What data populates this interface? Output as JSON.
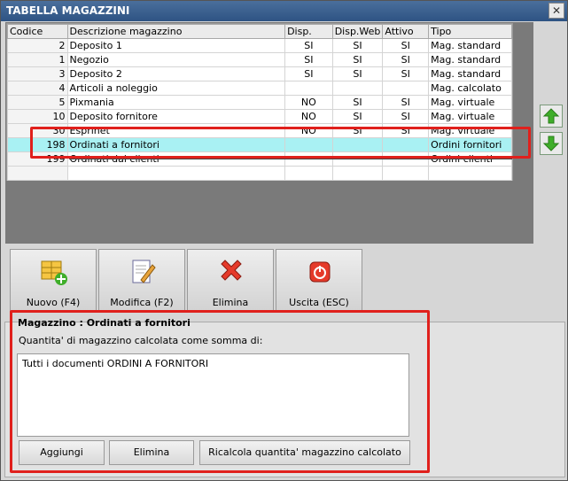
{
  "window": {
    "title": "TABELLA MAGAZZINI",
    "close_glyph": "✕"
  },
  "grid": {
    "columns": [
      "Codice",
      "Descrizione magazzino",
      "Disp.",
      "Disp.Web",
      "Attivo",
      "Tipo"
    ],
    "rows": [
      {
        "code": "2",
        "desc": "Deposito 1",
        "disp": "SI",
        "dispweb": "SI",
        "attivo": "SI",
        "tipo": "Mag. standard"
      },
      {
        "code": "1",
        "desc": "Negozio",
        "disp": "SI",
        "dispweb": "SI",
        "attivo": "SI",
        "tipo": "Mag. standard"
      },
      {
        "code": "3",
        "desc": "Deposito 2",
        "disp": "SI",
        "dispweb": "SI",
        "attivo": "SI",
        "tipo": "Mag. standard"
      },
      {
        "code": "4",
        "desc": "Articoli a noleggio",
        "disp": "",
        "dispweb": "",
        "attivo": "",
        "tipo": "Mag. calcolato"
      },
      {
        "code": "5",
        "desc": "Pixmania",
        "disp": "NO",
        "dispweb": "SI",
        "attivo": "SI",
        "tipo": "Mag. virtuale"
      },
      {
        "code": "10",
        "desc": "Deposito fornitore",
        "disp": "NO",
        "dispweb": "SI",
        "attivo": "SI",
        "tipo": "Mag. virtuale"
      },
      {
        "code": "30",
        "desc": "Esprinet",
        "disp": "NO",
        "dispweb": "SI",
        "attivo": "SI",
        "tipo": "Mag. virtuale"
      },
      {
        "code": "198",
        "desc": "Ordinati a fornitori",
        "disp": "",
        "dispweb": "",
        "attivo": "",
        "tipo": "Ordini fornitori"
      },
      {
        "code": "199",
        "desc": "Ordinati dai clienti",
        "disp": "",
        "dispweb": "",
        "attivo": "",
        "tipo": "Ordini clienti"
      }
    ],
    "selected_index": 7
  },
  "toolbar": {
    "new_label": "Nuovo (F4)",
    "edit_label": "Modifica (F2)",
    "delete_label": "Elimina",
    "exit_label": "Uscita (ESC)"
  },
  "detail": {
    "title": "Magazzino : Ordinati a fornitori",
    "hint": "Quantita' di magazzino calcolata come somma di:",
    "memo": "Tutti i documenti ORDINI A FORNITORI",
    "add_label": "Aggiungi",
    "remove_label": "Elimina",
    "recalc_label": "Ricalcola quantita' magazzino calcolato"
  },
  "colors": {
    "highlight": "#e0201c",
    "selection": "#a9f1f3",
    "title_bar": "#2e5383"
  }
}
